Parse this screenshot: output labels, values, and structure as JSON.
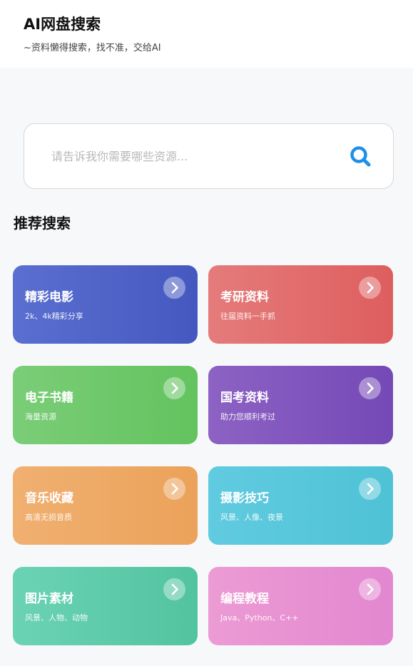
{
  "header": {
    "title": "AI网盘搜索",
    "subtitle": "~资料懒得搜索，找不准，交给AI"
  },
  "search": {
    "placeholder": "请告诉我你需要哪些资源...",
    "icon": "search-icon",
    "icon_color": "#1e90e8"
  },
  "section": {
    "title": "推荐搜索"
  },
  "cards": [
    {
      "title": "精彩电影",
      "desc": "2k、4k精彩分享",
      "icon": "chevron-right-icon",
      "color_start": "#5a6fd0",
      "color_end": "#4558c0"
    },
    {
      "title": "考研资料",
      "desc": "往届资料一手抓",
      "icon": "chevron-right-icon",
      "color_start": "#e57b7b",
      "color_end": "#de5e5e"
    },
    {
      "title": "电子书籍",
      "desc": "海量资源",
      "icon": "chevron-right-icon",
      "color_start": "#7bcd78",
      "color_end": "#63c35e"
    },
    {
      "title": "国考资料",
      "desc": "助力您顺利考过",
      "icon": "chevron-right-icon",
      "color_start": "#8d62c4",
      "color_end": "#7549b6"
    },
    {
      "title": "音乐收藏",
      "desc": "高清无损音质",
      "icon": "chevron-right-icon",
      "color_start": "#f0b071",
      "color_end": "#eba25a"
    },
    {
      "title": "摄影技巧",
      "desc": "风景、人像、夜景",
      "icon": "chevron-right-icon",
      "color_start": "#61cbe0",
      "color_end": "#4fc2d6"
    },
    {
      "title": "图片素材",
      "desc": "风景、人物、动物",
      "icon": "chevron-right-icon",
      "color_start": "#6bd3b4",
      "color_end": "#52c39f"
    },
    {
      "title": "编程教程",
      "desc": "Java、Python、C++",
      "icon": "chevron-right-icon",
      "color_start": "#ec9bd4",
      "color_end": "#e287d0"
    }
  ]
}
